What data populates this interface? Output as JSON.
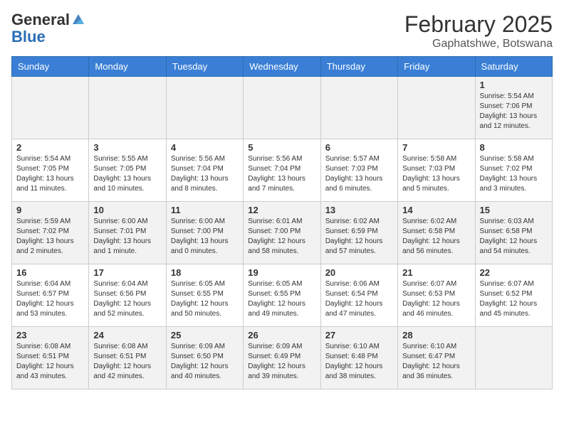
{
  "header": {
    "logo_general": "General",
    "logo_blue": "Blue",
    "month": "February 2025",
    "location": "Gaphatshwe, Botswana"
  },
  "days_of_week": [
    "Sunday",
    "Monday",
    "Tuesday",
    "Wednesday",
    "Thursday",
    "Friday",
    "Saturday"
  ],
  "weeks": [
    [
      {
        "day": "",
        "info": ""
      },
      {
        "day": "",
        "info": ""
      },
      {
        "day": "",
        "info": ""
      },
      {
        "day": "",
        "info": ""
      },
      {
        "day": "",
        "info": ""
      },
      {
        "day": "",
        "info": ""
      },
      {
        "day": "1",
        "info": "Sunrise: 5:54 AM\nSunset: 7:06 PM\nDaylight: 13 hours and 12 minutes."
      }
    ],
    [
      {
        "day": "2",
        "info": "Sunrise: 5:54 AM\nSunset: 7:05 PM\nDaylight: 13 hours and 11 minutes."
      },
      {
        "day": "3",
        "info": "Sunrise: 5:55 AM\nSunset: 7:05 PM\nDaylight: 13 hours and 10 minutes."
      },
      {
        "day": "4",
        "info": "Sunrise: 5:56 AM\nSunset: 7:04 PM\nDaylight: 13 hours and 8 minutes."
      },
      {
        "day": "5",
        "info": "Sunrise: 5:56 AM\nSunset: 7:04 PM\nDaylight: 13 hours and 7 minutes."
      },
      {
        "day": "6",
        "info": "Sunrise: 5:57 AM\nSunset: 7:03 PM\nDaylight: 13 hours and 6 minutes."
      },
      {
        "day": "7",
        "info": "Sunrise: 5:58 AM\nSunset: 7:03 PM\nDaylight: 13 hours and 5 minutes."
      },
      {
        "day": "8",
        "info": "Sunrise: 5:58 AM\nSunset: 7:02 PM\nDaylight: 13 hours and 3 minutes."
      }
    ],
    [
      {
        "day": "9",
        "info": "Sunrise: 5:59 AM\nSunset: 7:02 PM\nDaylight: 13 hours and 2 minutes."
      },
      {
        "day": "10",
        "info": "Sunrise: 6:00 AM\nSunset: 7:01 PM\nDaylight: 13 hours and 1 minute."
      },
      {
        "day": "11",
        "info": "Sunrise: 6:00 AM\nSunset: 7:00 PM\nDaylight: 13 hours and 0 minutes."
      },
      {
        "day": "12",
        "info": "Sunrise: 6:01 AM\nSunset: 7:00 PM\nDaylight: 12 hours and 58 minutes."
      },
      {
        "day": "13",
        "info": "Sunrise: 6:02 AM\nSunset: 6:59 PM\nDaylight: 12 hours and 57 minutes."
      },
      {
        "day": "14",
        "info": "Sunrise: 6:02 AM\nSunset: 6:58 PM\nDaylight: 12 hours and 56 minutes."
      },
      {
        "day": "15",
        "info": "Sunrise: 6:03 AM\nSunset: 6:58 PM\nDaylight: 12 hours and 54 minutes."
      }
    ],
    [
      {
        "day": "16",
        "info": "Sunrise: 6:04 AM\nSunset: 6:57 PM\nDaylight: 12 hours and 53 minutes."
      },
      {
        "day": "17",
        "info": "Sunrise: 6:04 AM\nSunset: 6:56 PM\nDaylight: 12 hours and 52 minutes."
      },
      {
        "day": "18",
        "info": "Sunrise: 6:05 AM\nSunset: 6:55 PM\nDaylight: 12 hours and 50 minutes."
      },
      {
        "day": "19",
        "info": "Sunrise: 6:05 AM\nSunset: 6:55 PM\nDaylight: 12 hours and 49 minutes."
      },
      {
        "day": "20",
        "info": "Sunrise: 6:06 AM\nSunset: 6:54 PM\nDaylight: 12 hours and 47 minutes."
      },
      {
        "day": "21",
        "info": "Sunrise: 6:07 AM\nSunset: 6:53 PM\nDaylight: 12 hours and 46 minutes."
      },
      {
        "day": "22",
        "info": "Sunrise: 6:07 AM\nSunset: 6:52 PM\nDaylight: 12 hours and 45 minutes."
      }
    ],
    [
      {
        "day": "23",
        "info": "Sunrise: 6:08 AM\nSunset: 6:51 PM\nDaylight: 12 hours and 43 minutes."
      },
      {
        "day": "24",
        "info": "Sunrise: 6:08 AM\nSunset: 6:51 PM\nDaylight: 12 hours and 42 minutes."
      },
      {
        "day": "25",
        "info": "Sunrise: 6:09 AM\nSunset: 6:50 PM\nDaylight: 12 hours and 40 minutes."
      },
      {
        "day": "26",
        "info": "Sunrise: 6:09 AM\nSunset: 6:49 PM\nDaylight: 12 hours and 39 minutes."
      },
      {
        "day": "27",
        "info": "Sunrise: 6:10 AM\nSunset: 6:48 PM\nDaylight: 12 hours and 38 minutes."
      },
      {
        "day": "28",
        "info": "Sunrise: 6:10 AM\nSunset: 6:47 PM\nDaylight: 12 hours and 36 minutes."
      },
      {
        "day": "",
        "info": ""
      }
    ]
  ]
}
